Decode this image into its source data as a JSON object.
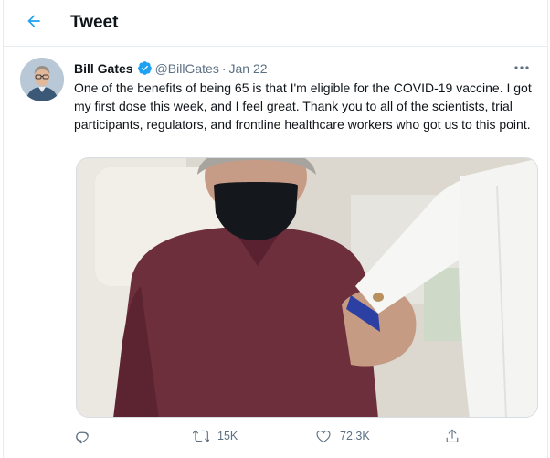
{
  "header": {
    "title": "Tweet",
    "back_icon": "arrow-left-icon"
  },
  "colors": {
    "accent": "#1da1f2",
    "text_primary": "#0f1419",
    "text_secondary": "#5b7083",
    "border": "#e6ecf0"
  },
  "tweet": {
    "author_name": "Bill Gates",
    "verified": true,
    "handle": "@BillGates",
    "separator": "·",
    "date": "Jan 22",
    "text": "One of the benefits of being 65 is that I'm eligible for the COVID-19 vaccine. I got my first dose this week, and I feel great. Thank you to all of the scientists, trial participants, regulators, and frontline healthcare workers who got us to this point.",
    "media_icon": "photo",
    "actions": {
      "reply": {
        "icon": "reply-icon",
        "count": ""
      },
      "retweet": {
        "icon": "retweet-icon",
        "count": "15K"
      },
      "like": {
        "icon": "heart-icon",
        "count": "72.3K"
      },
      "share": {
        "icon": "share-icon",
        "count": ""
      }
    }
  }
}
